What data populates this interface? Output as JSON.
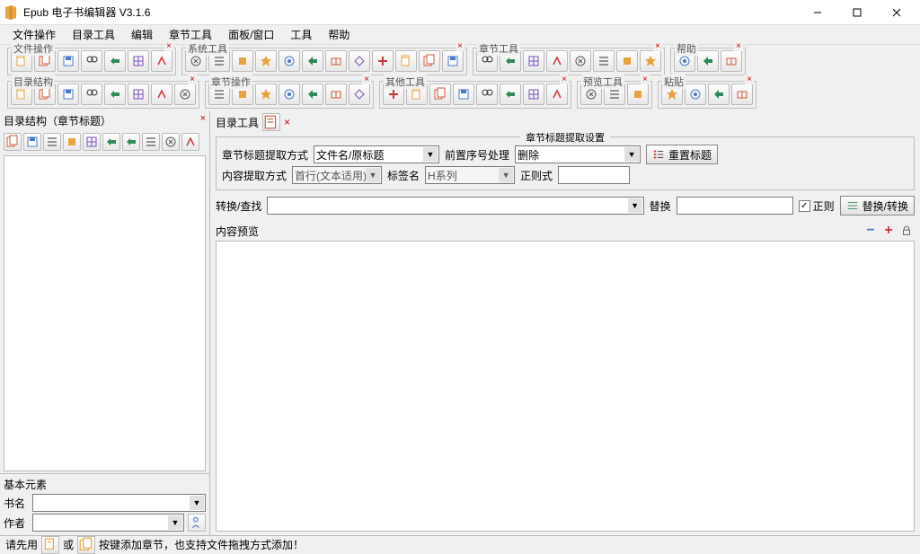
{
  "window": {
    "title": "Epub 电子书编辑器 V3.1.6"
  },
  "menu": {
    "items": [
      "文件操作",
      "目录工具",
      "编辑",
      "章节工具",
      "面板/窗口",
      "工具",
      "帮助"
    ]
  },
  "toolgroups_row1": [
    {
      "label": "文件操作",
      "count": 7
    },
    {
      "label": "系统工具",
      "count": 12
    },
    {
      "label": "章节工具",
      "count": 8
    },
    {
      "label": "帮助",
      "count": 3
    }
  ],
  "toolgroups_row2": [
    {
      "label": "目录结构",
      "count": 8
    },
    {
      "label": "章节操作",
      "count": 7
    },
    {
      "label": "其他工具",
      "count": 8
    },
    {
      "label": "预览工具",
      "count": 3
    },
    {
      "label": "粘贴",
      "count": 4
    }
  ],
  "left": {
    "panel_title": "目录结构（章节标题）",
    "basic_header": "基本元素",
    "book_name_label": "书名",
    "author_label": "作者",
    "book_name_value": "",
    "author_value": ""
  },
  "right": {
    "header": "目录工具",
    "fieldset_legend": "章节标题提取设置",
    "extract_method_label": "章节标题提取方式",
    "extract_method_value": "文件名/原标题",
    "prefix_label": "前置序号处理",
    "prefix_value": "删除",
    "reset_button": "重置标题",
    "content_method_label": "内容提取方式",
    "content_method_value": "首行(文本适用)",
    "tag_label": "标签名",
    "tag_value": "H系列",
    "regex_label": "正则式",
    "search_label": "转换/查找",
    "replace_label": "替换",
    "regex_check": "正则",
    "replace_button": "替换/转换",
    "preview_header": "内容预览"
  },
  "status": {
    "text_before": "请先用",
    "text_mid": "或",
    "text_after": "按键添加章节，也支持文件拖拽方式添加！"
  },
  "icon_colors": {
    "folder": "#e8a33d",
    "page": "#c95b3a",
    "blue": "#4a7bc8",
    "red": "#d13438",
    "green": "#2e8b57",
    "purple": "#7a4fc0",
    "gray": "#777"
  }
}
